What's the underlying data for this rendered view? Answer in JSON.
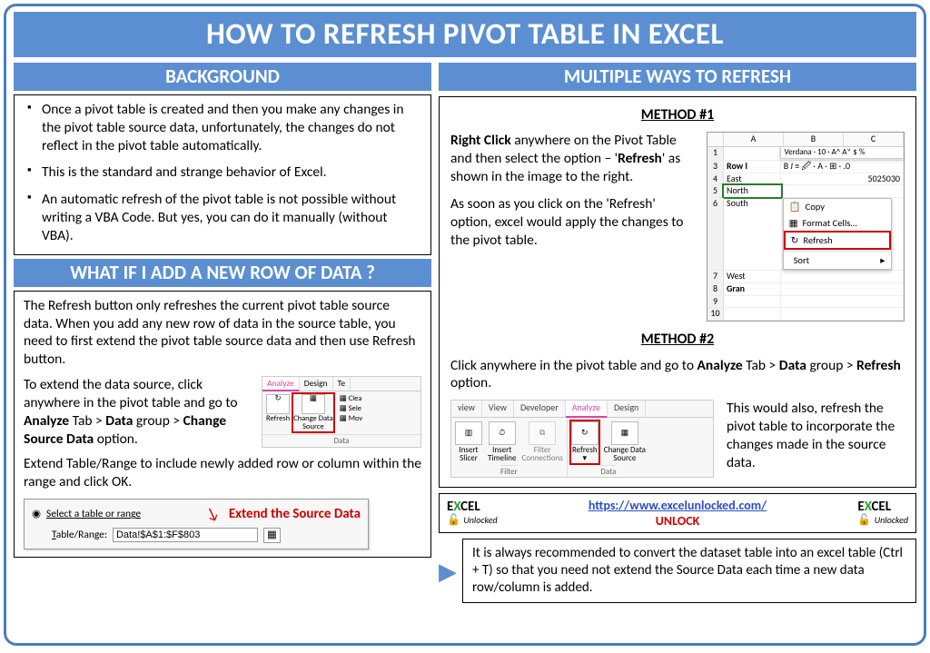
{
  "title": "HOW TO REFRESH PIVOT TABLE IN EXCEL",
  "left": {
    "background": {
      "heading": "BACKGROUND",
      "b1": "Once a pivot table is created and then you make any changes in the pivot table source data, unfortunately, the changes do not reflect in the pivot table automatically.",
      "b2": "This is the standard and strange behavior of Excel.",
      "b3": "An automatic refresh of the pivot table is not possible without writing a VBA Code. But yes, you can do it manually (without VBA)."
    },
    "newrow": {
      "heading": "WHAT IF I ADD A NEW ROW OF DATA ?",
      "p1": "The Refresh button only refreshes the current pivot table source data. When you add any new row of data in the source table, you need to first extend the pivot table source data and then use Refresh button.",
      "p2a": "To extend the data source, click anywhere in the pivot table and go to ",
      "p2b": "Analyze",
      "p2c": " Tab > ",
      "p2d": "Data",
      "p2e": " group > ",
      "p2f": "Change Source Data",
      "p2g": " option.",
      "p3": "Extend Table/Range to include newly added row or column within the range and click OK.",
      "dlg_opt": "Select a table or range",
      "dlg_lbl": "Table/Range:",
      "dlg_val": "Data!$A$1:$F$803",
      "extend": "Extend the Source Data",
      "ribbon": {
        "t_analyze": "Analyze",
        "t_design": "Design",
        "t_te": "Te",
        "refresh": "Refresh",
        "change": "Change Data\nSource",
        "clea": "Clea",
        "sele": "Sele",
        "mov": "Mov",
        "grp": "Data"
      }
    }
  },
  "right": {
    "heading": "MULTIPLE WAYS TO REFRESH",
    "m1": {
      "label": "METHOD #1",
      "p1a": "Right Click",
      "p1b": " anywhere on the Pivot Table and then select the option – '",
      "p1c": "Refresh",
      "p1d": "' as shown in the image to the right.",
      "p2": "As soon as you click on the 'Refresh' option, excel would apply the changes to the pivot table.",
      "sheet": {
        "cols": [
          "",
          "A",
          "B",
          "C"
        ],
        "r1": "1",
        "r3": "3",
        "r4": "4",
        "r5": "5",
        "r6": "6",
        "r7": "7",
        "r8": "8",
        "r9": "9",
        "r10": "10",
        "rowl": "Row l",
        "east": "East",
        "north": "North",
        "south": "South",
        "west": "West",
        "grand": "Gran",
        "font": "Verdana",
        "size": "10",
        "copy": "Copy",
        "format": "Format Cells…",
        "refresh": "Refresh",
        "sort": "Sort"
      }
    },
    "m2": {
      "label": "METHOD #2",
      "p1a": "Click anywhere in the pivot table and go to ",
      "p1b": "Analyze",
      "p1c": " Tab > ",
      "p1d": "Data",
      "p1e": " group > ",
      "p1f": "Refresh",
      "p1g": " option.",
      "p2": "This would also, refresh the pivot table to incorporate the changes made in the source data.",
      "ribbon": {
        "view1": "view",
        "view": "View",
        "dev": "Developer",
        "analyze": "Analyze",
        "design": "Design",
        "slicer": "Insert\nSlicer",
        "timeline": "Insert\nTimeline",
        "fconn": "Filter\nConnections",
        "refresh": "Refresh",
        "chg": "Change Data\nSource",
        "g_filter": "Filter",
        "g_data": "Data"
      }
    }
  },
  "footer": {
    "link": "https://www.excelunlocked.com/",
    "unlock": "UNLOCK",
    "logo_top": "E CEL",
    "logo_x": "X",
    "logo_sub": "Unlocked"
  },
  "tip": {
    "text": "It is always recommended to convert the dataset table into an excel table (Ctrl + T) so that you need not extend the Source Data each time a new data row/column is added."
  }
}
